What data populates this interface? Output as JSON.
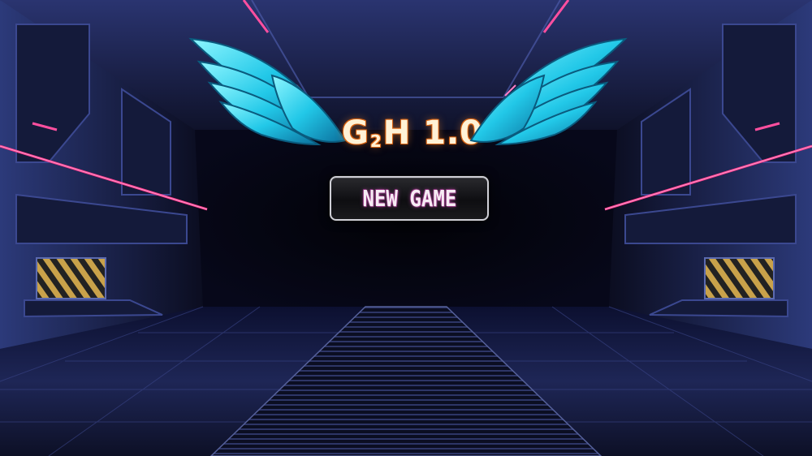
{
  "title": {
    "main": "G",
    "subscript": "2",
    "rest": "H 1.0"
  },
  "menu": {
    "new_game_label": "NEW GAME"
  },
  "colors": {
    "title_fill": "#fff2d6",
    "title_outline": "#d35e10",
    "wing_cyan": "#2ee0f0",
    "neon_pink": "#ff3b8d",
    "button_border": "#cfcfd6"
  },
  "icons": {
    "left_wing": "left-wing-icon",
    "right_wing": "right-wing-icon"
  }
}
